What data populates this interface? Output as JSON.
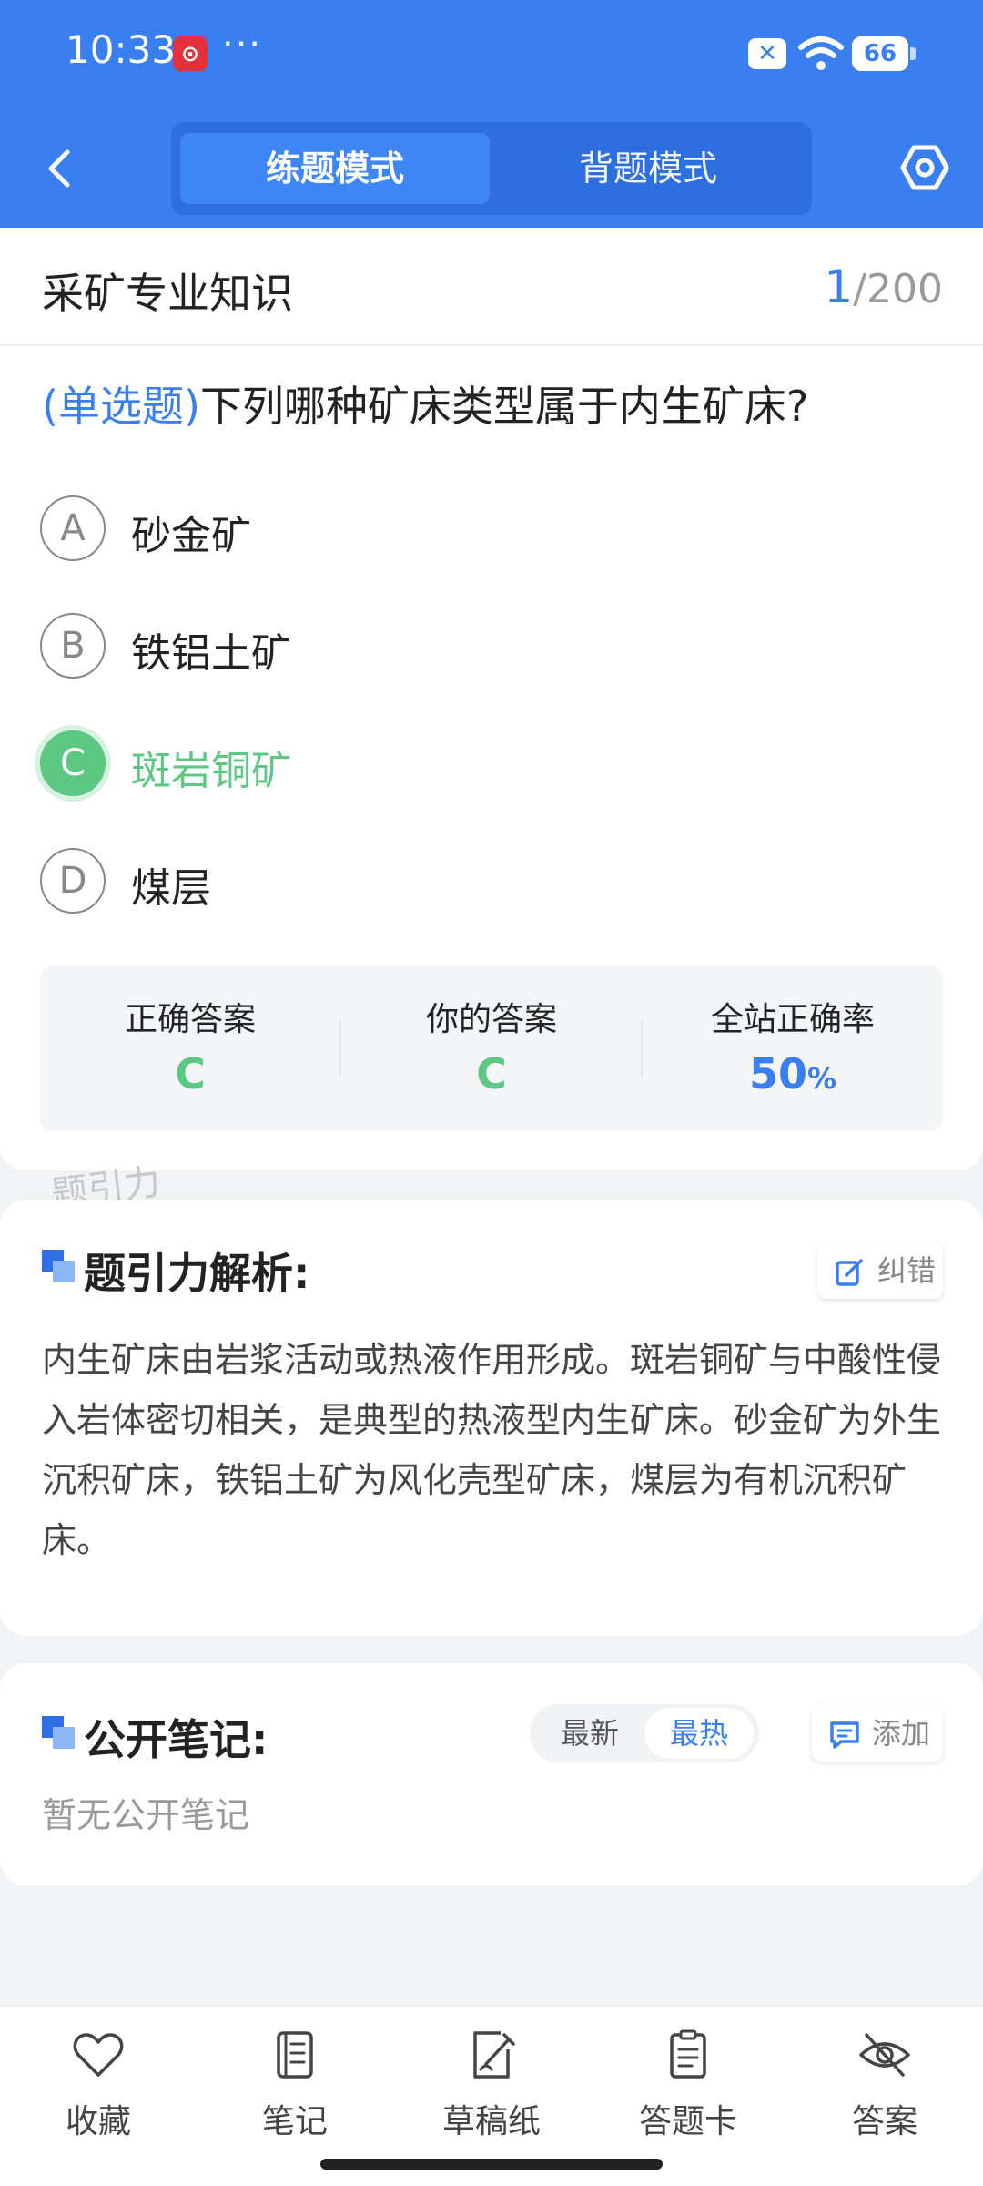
{
  "status_bar": {
    "time": "10:33",
    "app_icon": "netease-music-icon",
    "more": "···",
    "battery": "66"
  },
  "header": {
    "modes": [
      "练题模式",
      "背题模式"
    ],
    "active_mode": "练题模式",
    "accent_color": "#3a7ff0"
  },
  "question": {
    "subject": "采矿专业知识",
    "current": "1",
    "total": "/200",
    "type_label": "(单选题)",
    "text": "下列哪种矿床类型属于内生矿床?",
    "options": [
      {
        "key": "A",
        "label": "砂金矿"
      },
      {
        "key": "B",
        "label": "铁铝土矿"
      },
      {
        "key": "C",
        "label": "斑岩铜矿"
      },
      {
        "key": "D",
        "label": "煤层"
      }
    ],
    "selected": "C",
    "correct_color": "#5dc884"
  },
  "stats": {
    "correct_label": "正确答案",
    "correct_value": "C",
    "yours_label": "你的答案",
    "yours_value": "C",
    "rate_label": "全站正确率",
    "rate_value": "50",
    "rate_unit": "%"
  },
  "watermark": "题引力",
  "analysis": {
    "title": "题引力解析:",
    "report_label": "纠错",
    "text": "内生矿床由岩浆活动或热液作用形成。斑岩铜矿与中酸性侵入岩体密切相关，是典型的热液型内生矿床。砂金矿为外生沉积矿床，铁铝土矿为风化壳型矿床，煤层为有机沉积矿床。"
  },
  "notes": {
    "title": "公开笔记:",
    "sort_options": [
      "最新",
      "最热"
    ],
    "active_sort": "最热",
    "add_label": "添加",
    "empty_text": "暂无公开笔记"
  },
  "bottom_tabs": [
    {
      "label": "收藏",
      "icon": "heart-icon"
    },
    {
      "label": "笔记",
      "icon": "notebook-icon"
    },
    {
      "label": "草稿纸",
      "icon": "draft-paper-icon"
    },
    {
      "label": "答题卡",
      "icon": "answer-sheet-icon"
    },
    {
      "label": "答案",
      "icon": "eye-off-icon"
    }
  ]
}
